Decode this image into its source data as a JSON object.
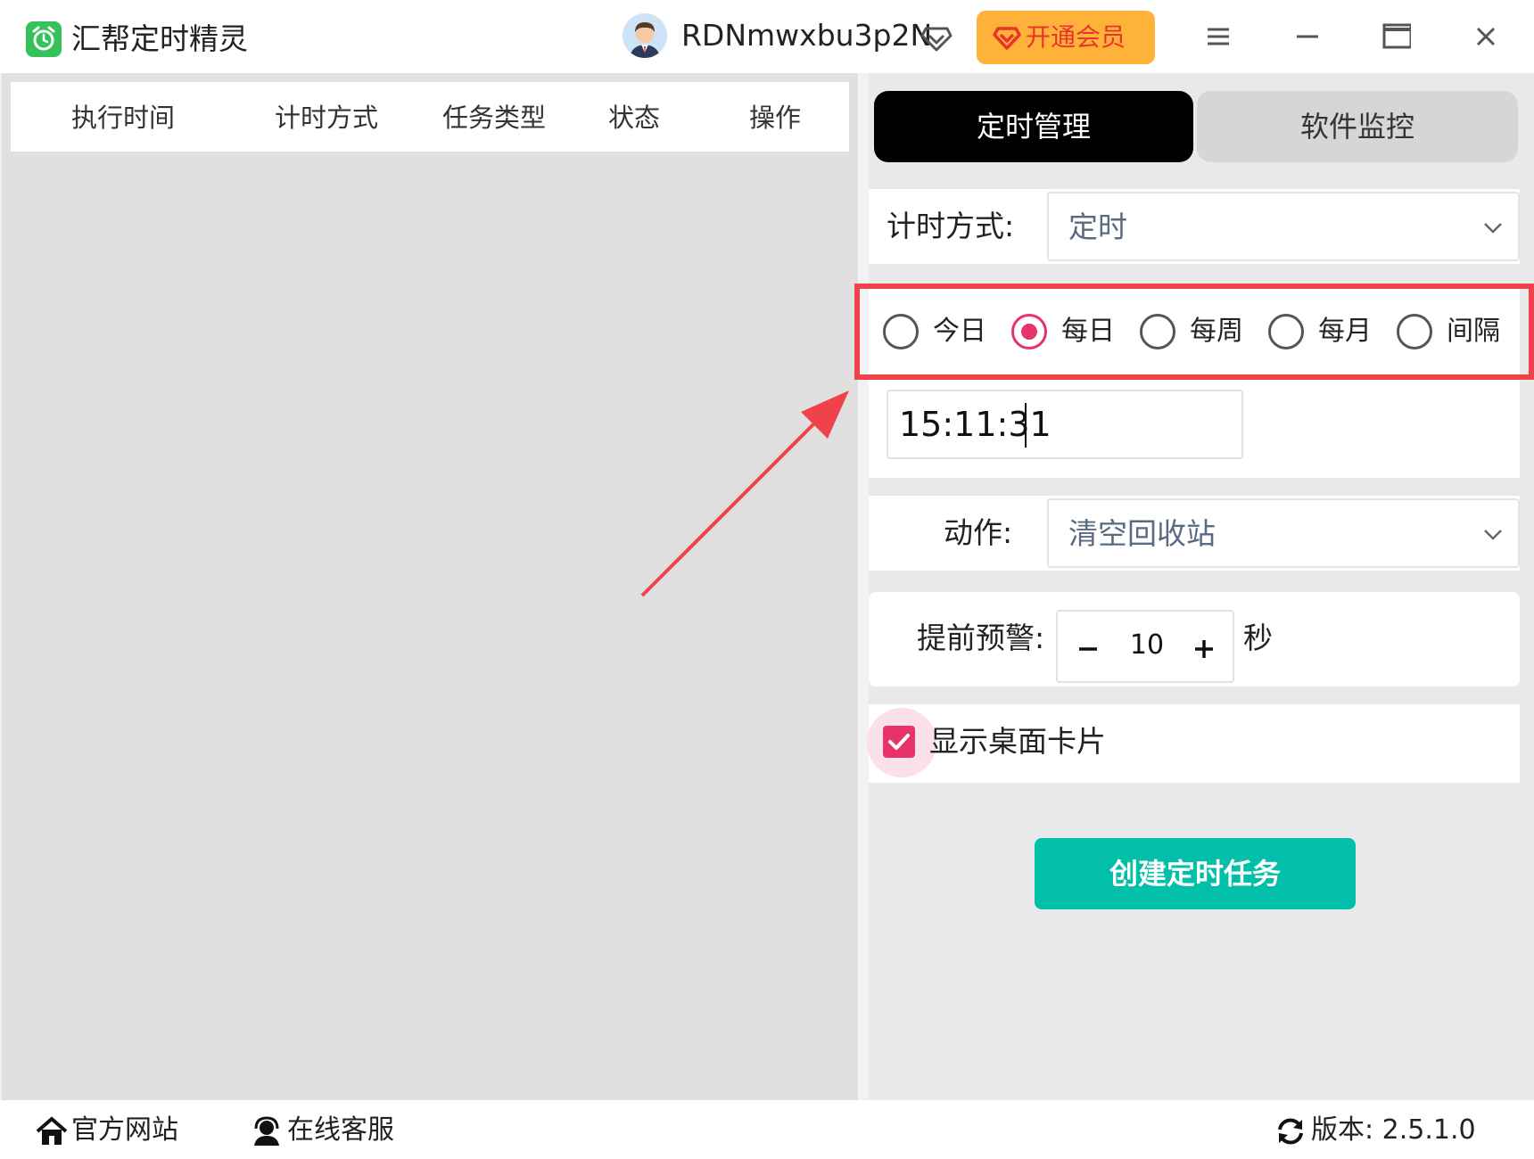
{
  "app": {
    "title": "汇帮定时精灵",
    "username": "RDNmwxbu3p2N",
    "vip_label": "开通会员"
  },
  "table": {
    "columns": [
      "执行时间",
      "计时方式",
      "任务类型",
      "状态",
      "操作"
    ]
  },
  "tabs": [
    {
      "label": "定时管理",
      "active": true
    },
    {
      "label": "软件监控",
      "active": false
    }
  ],
  "form": {
    "timing_label": "计时方式:",
    "timing_value": "定时",
    "frequency_options": [
      {
        "label": "今日",
        "selected": false
      },
      {
        "label": "每日",
        "selected": true
      },
      {
        "label": "每周",
        "selected": false
      },
      {
        "label": "每月",
        "selected": false
      },
      {
        "label": "间隔",
        "selected": false
      }
    ],
    "time_value": "15:11:31",
    "action_label": "动作:",
    "action_value": "清空回收站",
    "warning_label": "提前预警:",
    "warning_value": "10",
    "warning_unit": "秒",
    "show_card_label": "显示桌面卡片",
    "show_card_checked": true,
    "create_button": "创建定时任务"
  },
  "footer": {
    "website": "官方网站",
    "support": "在线客服",
    "version": "版本: 2.5.1.0"
  },
  "colors": {
    "accent": "#e8336a",
    "primary_button": "#02bfa9",
    "vip_button": "#ffb23a",
    "highlight": "#f0424b",
    "active_tab": "#000000"
  }
}
